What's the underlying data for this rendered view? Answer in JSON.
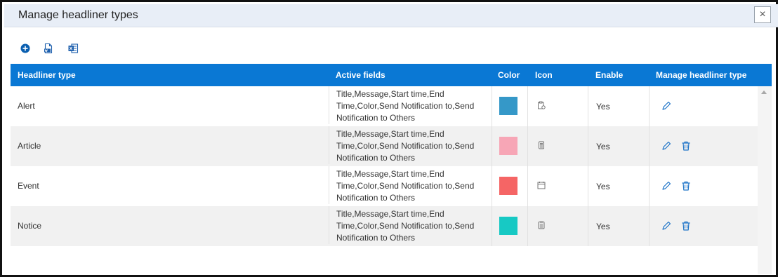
{
  "dialog": {
    "title": "Manage headliner types",
    "close_glyph": "×"
  },
  "toolbar": {
    "icons": [
      "add-circle-icon",
      "export-word-icon",
      "export-excel-icon"
    ],
    "accent": "#0a78d4"
  },
  "table": {
    "columns": [
      "Headliner type",
      "Active fields",
      "Color",
      "Icon",
      "Enable",
      "Manage headliner type"
    ],
    "header_color": "#0a78d4",
    "rows": [
      {
        "type": "Alert",
        "fields": "Title,Message,Start time,End Time,Color,Send Notification to,Send Notification to Others",
        "color": "#3598c8",
        "icon": "clipboard-alert-icon",
        "enable": "Yes",
        "actions": [
          "edit"
        ]
      },
      {
        "type": "Article",
        "fields": "Title,Message,Start time,End Time,Color,Send Notification to,Send Notification to Others",
        "color": "#f7a6b6",
        "icon": "document-icon",
        "enable": "Yes",
        "actions": [
          "edit",
          "delete"
        ]
      },
      {
        "type": "Event",
        "fields": "Title,Message,Start time,End Time,Color,Send Notification to,Send Notification to Others",
        "color": "#f56565",
        "icon": "calendar-icon",
        "enable": "Yes",
        "actions": [
          "edit",
          "delete"
        ]
      },
      {
        "type": "Notice",
        "fields": "Title,Message,Start time,End Time,Color,Send Notification to,Send Notification to Others",
        "color": "#17c9c4",
        "icon": "notice-icon",
        "enable": "Yes",
        "actions": [
          "edit",
          "delete"
        ]
      }
    ]
  }
}
